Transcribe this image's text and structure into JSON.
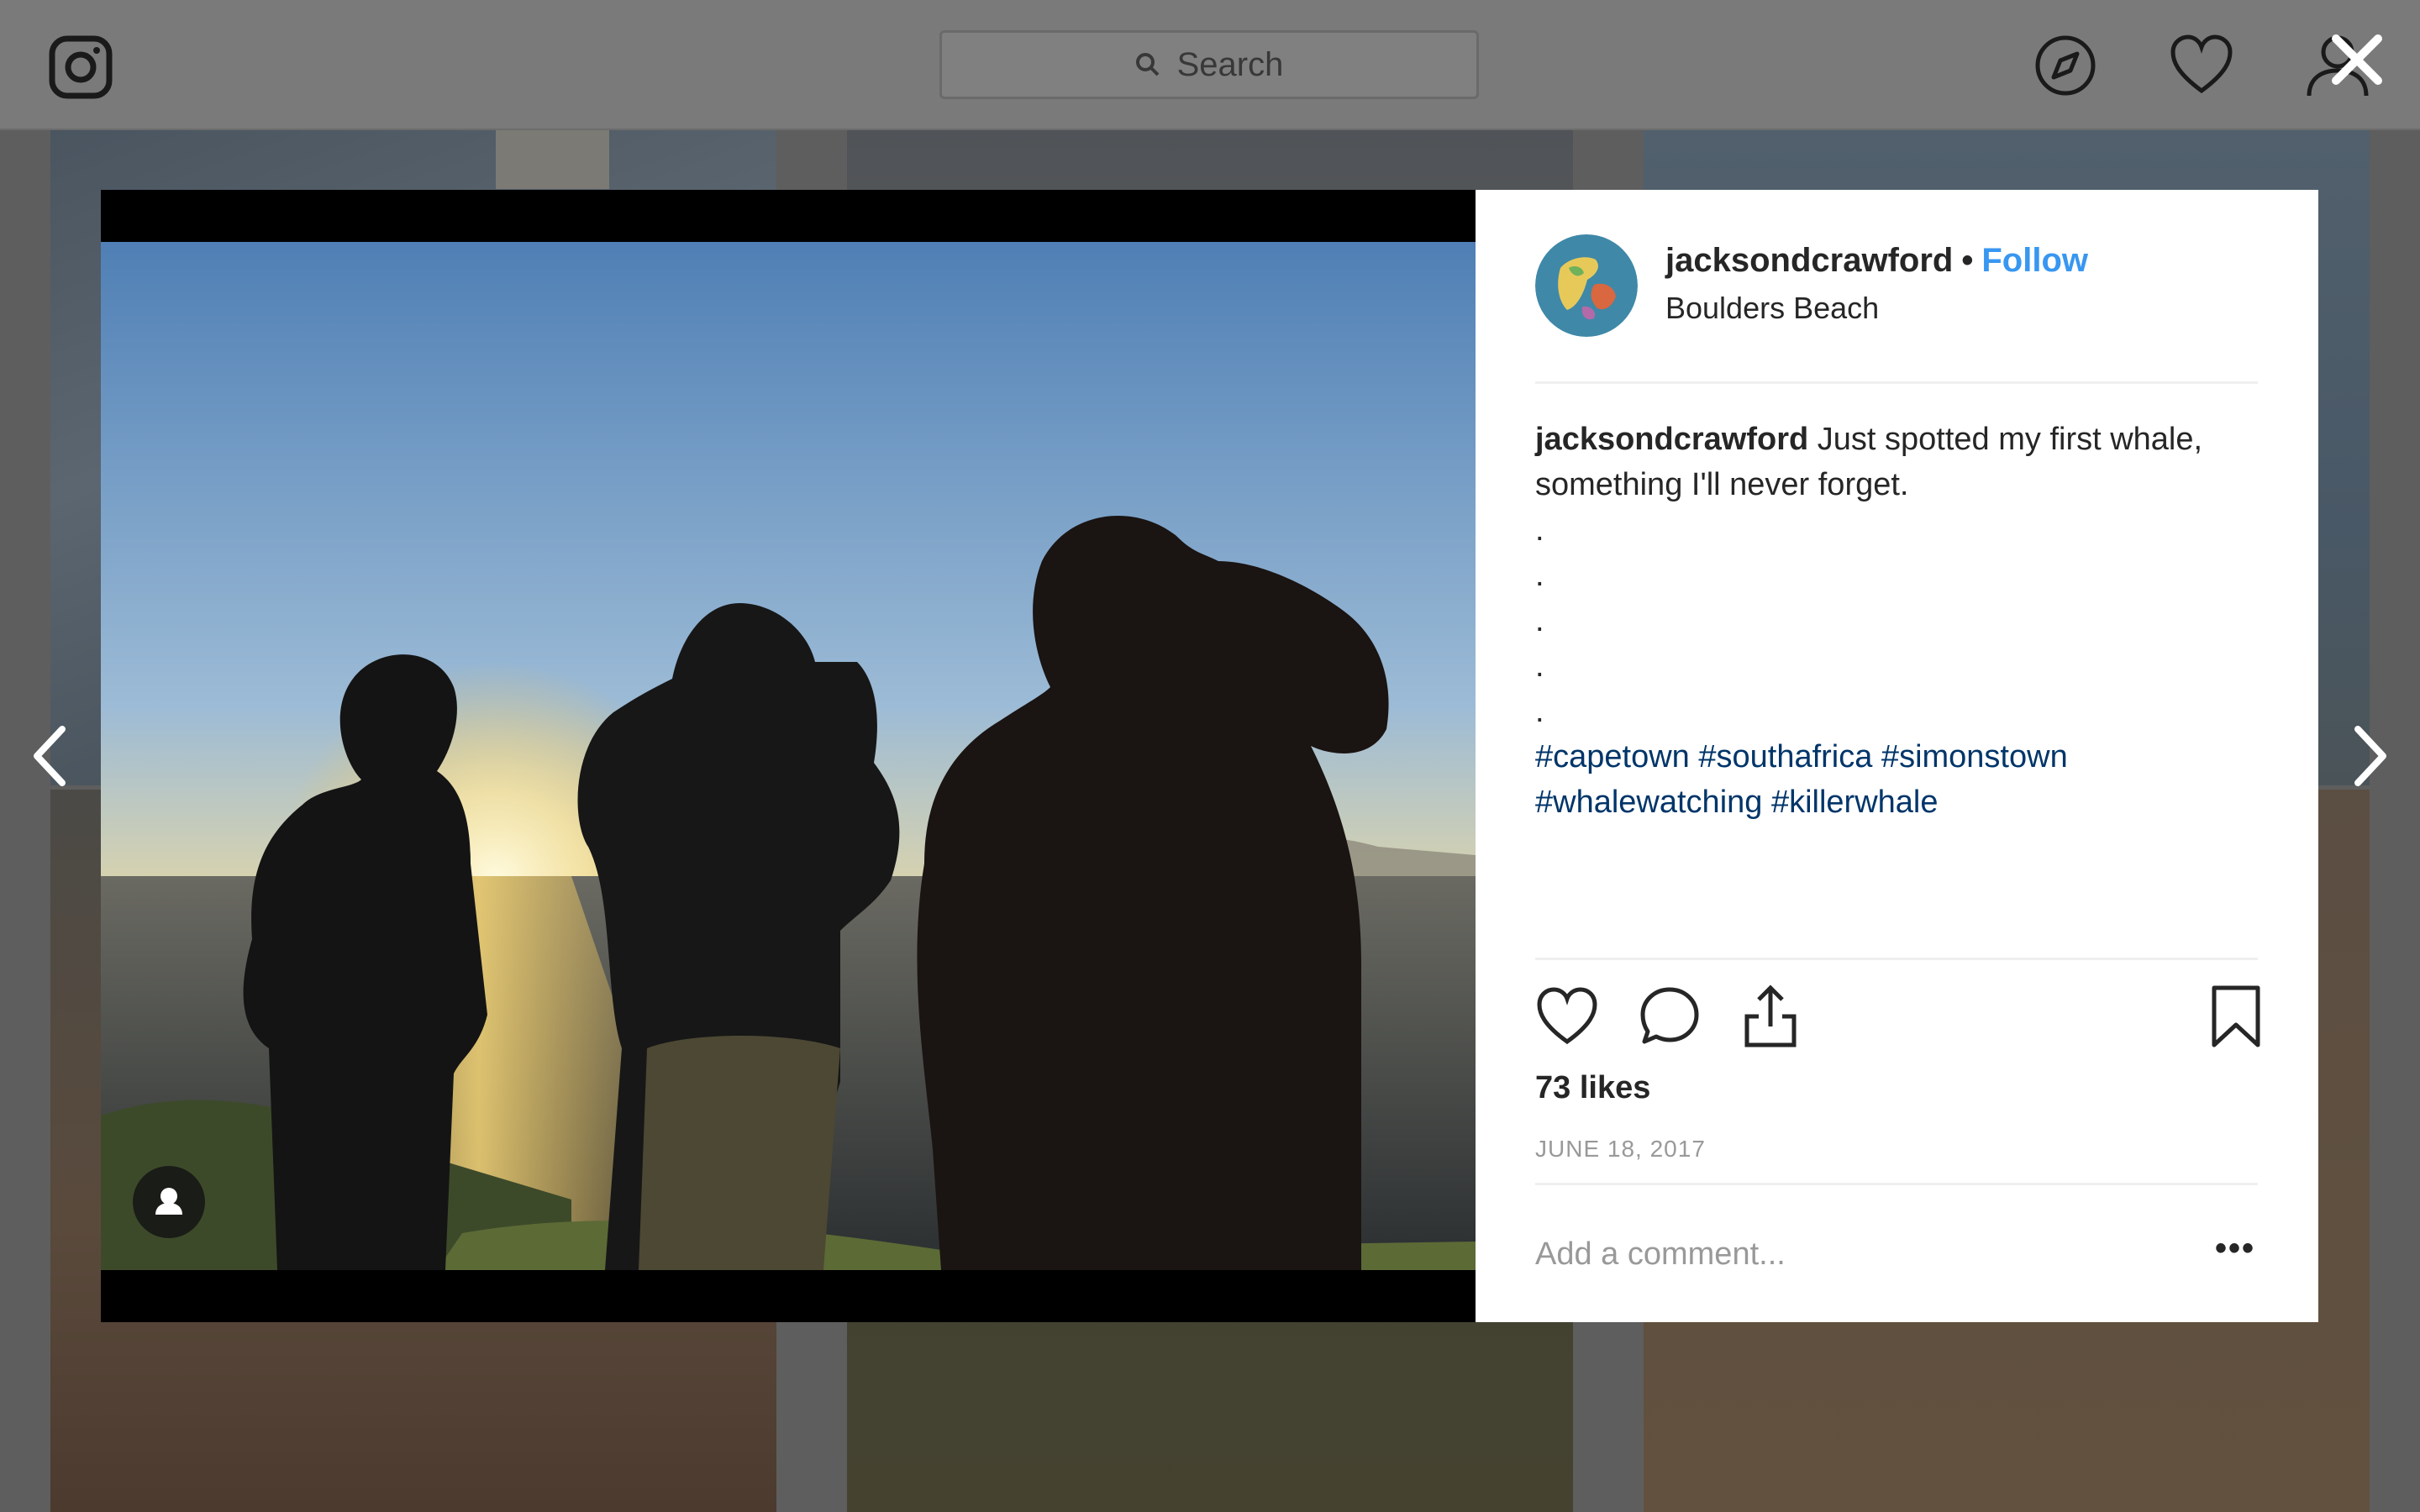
{
  "header": {
    "search_placeholder": "Search",
    "icons": [
      "instagram-logo-icon",
      "search-icon",
      "explore-compass-icon",
      "activity-heart-icon",
      "profile-icon",
      "close-icon"
    ]
  },
  "modal": {
    "close_icon": "close-icon",
    "prev_icon": "chevron-left-icon",
    "next_icon": "chevron-right-icon",
    "photo": {
      "description_icon": "tagged-user-icon"
    },
    "post": {
      "username": "jacksondcrawford",
      "separator": "•",
      "follow_label": "Follow",
      "location": "Boulders Beach",
      "caption_username": "jacksondcrawford",
      "caption_text": "Just spotted my first whale, something I'll never forget.",
      "caption_dots": [
        ".",
        ".",
        ".",
        ".",
        "."
      ],
      "hashtags_line1": "#capetown #southafrica #simonstown",
      "hashtags_line2": "#whalewatching #killerwhale",
      "likes": "73 likes",
      "date": "JUNE 18, 2017",
      "comment_placeholder": "Add a comment...",
      "more_label": "•••",
      "colors": {
        "follow": "#3897f0",
        "hashtag": "#003569",
        "text": "#262626",
        "muted": "#999999"
      }
    }
  }
}
